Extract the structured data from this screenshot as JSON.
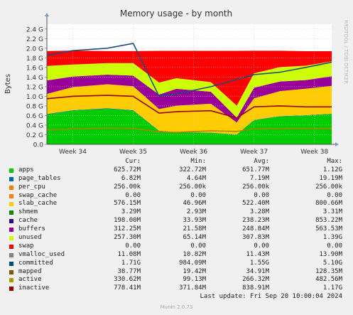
{
  "chart_data": {
    "type": "area",
    "title": "Memory usage - by month",
    "ylabel": "Bytes",
    "side_label": "RRDTOOL / TOBI OETIKER",
    "ylim": [
      0,
      2.5
    ],
    "unit_suffix": "G",
    "yticks": [
      0,
      0.2,
      0.4,
      0.6,
      0.8,
      1.0,
      1.2,
      1.4,
      1.6,
      1.8,
      2.0,
      2.2,
      2.4
    ],
    "ytick_labels": [
      "0.0",
      "0.2 G",
      "0.4 G",
      "0.6 G",
      "0.8 G",
      "1.0 G",
      "1.2 G",
      "1.4 G",
      "1.6 G",
      "1.8 G",
      "2.0 G",
      "2.2 G",
      "2.4 G"
    ],
    "x_domain": [
      "2024-08-18",
      "2024-09-20"
    ],
    "x_ticks": [
      {
        "label": "Week 34",
        "date": "2024-08-21"
      },
      {
        "label": "Week 35",
        "date": "2024-08-28"
      },
      {
        "label": "Week 36",
        "date": "2024-09-04"
      },
      {
        "label": "Week 37",
        "date": "2024-09-11"
      },
      {
        "label": "Week 38",
        "date": "2024-09-18"
      }
    ],
    "x": [
      "2024-08-18",
      "2024-08-21",
      "2024-08-25",
      "2024-08-28",
      "2024-08-31",
      "2024-09-02",
      "2024-09-06",
      "2024-09-09",
      "2024-09-11",
      "2024-09-14",
      "2024-09-17",
      "2024-09-20"
    ],
    "grid": true,
    "stacked_series": [
      {
        "name": "apps",
        "color": "#00cc00",
        "values": [
          0.62,
          0.7,
          0.74,
          0.7,
          0.28,
          0.25,
          0.24,
          0.2,
          0.5,
          0.58,
          0.6,
          0.63
        ]
      },
      {
        "name": "page_tables",
        "color": "#0066b3",
        "values": [
          0.01,
          0.01,
          0.01,
          0.01,
          0.005,
          0.005,
          0.005,
          0.005,
          0.007,
          0.007,
          0.007,
          0.007
        ]
      },
      {
        "name": "per_cpu",
        "color": "#ff8000",
        "values": [
          0,
          0,
          0,
          0,
          0,
          0,
          0,
          0,
          0,
          0,
          0,
          0
        ]
      },
      {
        "name": "slab_cache",
        "color": "#ffcc00",
        "values": [
          0.42,
          0.48,
          0.5,
          0.5,
          0.45,
          0.55,
          0.6,
          0.25,
          0.45,
          0.52,
          0.55,
          0.58
        ]
      },
      {
        "name": "shmem",
        "color": "#330099",
        "values": [
          0,
          0,
          0,
          0,
          0,
          0,
          0,
          0,
          0,
          0,
          0,
          0
        ]
      },
      {
        "name": "cache",
        "color": "#990099",
        "values": [
          0.28,
          0.22,
          0.2,
          0.22,
          0.3,
          0.35,
          0.25,
          0.1,
          0.22,
          0.2,
          0.18,
          0.2
        ]
      },
      {
        "name": "buffers",
        "color": "#ccff00",
        "values": [
          0.3,
          0.25,
          0.24,
          0.26,
          0.25,
          0.22,
          0.2,
          0.25,
          0.3,
          0.3,
          0.3,
          0.31
        ]
      },
      {
        "name": "unused",
        "color": "#ff0000",
        "values": [
          0.31,
          0.29,
          0.25,
          0.25,
          0.66,
          0.57,
          0.65,
          1.14,
          0.47,
          0.34,
          0.3,
          0.21
        ]
      }
    ],
    "line_series": [
      {
        "name": "committed",
        "color": "#1f4e79",
        "values": [
          1.85,
          1.95,
          2.0,
          2.1,
          1.0,
          1.05,
          1.2,
          1.35,
          1.45,
          1.5,
          1.6,
          1.71
        ]
      },
      {
        "name": "active",
        "color": "#aa8800",
        "values": [
          0.3,
          0.32,
          0.34,
          0.33,
          0.26,
          0.25,
          0.28,
          0.27,
          0.32,
          0.33,
          0.33,
          0.33
        ]
      },
      {
        "name": "inactive",
        "color": "#990000",
        "values": [
          0.95,
          1.0,
          1.02,
          1.0,
          0.65,
          0.68,
          0.7,
          0.55,
          0.78,
          0.8,
          0.78,
          0.78
        ]
      }
    ],
    "legend_header": [
      "Cur:",
      "Min:",
      "Avg:",
      "Max:"
    ],
    "legend": [
      {
        "name": "apps",
        "color": "#00cc00",
        "cur": "625.72M",
        "min": "322.72M",
        "avg": "651.77M",
        "max": "1.12G"
      },
      {
        "name": "page_tables",
        "color": "#0066b3",
        "cur": "6.82M",
        "min": "4.64M",
        "avg": "7.19M",
        "max": "19.19M"
      },
      {
        "name": "per_cpu",
        "color": "#ff8000",
        "cur": "256.00k",
        "min": "256.00k",
        "avg": "256.00k",
        "max": "256.00k"
      },
      {
        "name": "swap_cache",
        "color": "#ff8000",
        "cur": "0.00",
        "min": "0.00",
        "avg": "0.00",
        "max": "0.00"
      },
      {
        "name": "slab_cache",
        "color": "#ffcc00",
        "cur": "576.15M",
        "min": "46.96M",
        "avg": "522.40M",
        "max": "800.66M"
      },
      {
        "name": "shmem",
        "color": "#008f00",
        "cur": "3.29M",
        "min": "2.93M",
        "avg": "3.28M",
        "max": "3.31M"
      },
      {
        "name": "cache",
        "color": "#330099",
        "cur": "198.00M",
        "min": "33.93M",
        "avg": "238.23M",
        "max": "853.22M"
      },
      {
        "name": "buffers",
        "color": "#990099",
        "cur": "312.25M",
        "min": "21.58M",
        "avg": "248.84M",
        "max": "563.53M"
      },
      {
        "name": "unused",
        "color": "#ccff00",
        "cur": "257.30M",
        "min": "65.14M",
        "avg": "307.83M",
        "max": "1.39G"
      },
      {
        "name": "swap",
        "color": "#ff0000",
        "cur": "0.00",
        "min": "0.00",
        "avg": "0.00",
        "max": "0.00"
      },
      {
        "name": "vmalloc_used",
        "color": "#808080",
        "cur": "11.08M",
        "min": "10.82M",
        "avg": "11.43M",
        "max": "13.90M"
      },
      {
        "name": "committed",
        "color": "#004b8a",
        "cur": "1.71G",
        "min": "984.09M",
        "avg": "1.55G",
        "max": "5.10G"
      },
      {
        "name": "mapped",
        "color": "#8a4f00",
        "cur": "38.77M",
        "min": "19.42M",
        "avg": "34.91M",
        "max": "128.35M"
      },
      {
        "name": "active",
        "color": "#aa9a00",
        "cur": "330.62M",
        "min": "99.13M",
        "avg": "266.32M",
        "max": "482.56M"
      },
      {
        "name": "inactive",
        "color": "#990000",
        "cur": "778.41M",
        "min": "371.84M",
        "avg": "838.91M",
        "max": "1.17G"
      }
    ]
  },
  "footer": {
    "last_update": "Last update: Fri Sep 20 10:00:04 2024",
    "munin": "Munin 2.0.73"
  }
}
